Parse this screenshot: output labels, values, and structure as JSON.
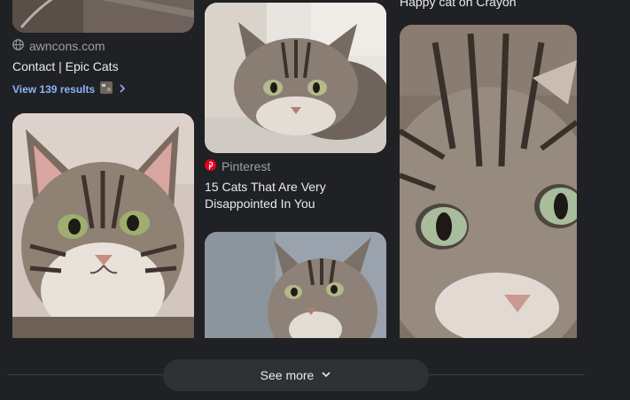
{
  "results": [
    {
      "source": "awncons.com",
      "title": "Contact | Epic Cats",
      "view_results": "View 139 results"
    },
    {
      "source": "Pinterest",
      "title_line1": "15 Cats That Are Very",
      "title_line2": "Disappointed In You"
    },
    {
      "title": "Happy cat on Crayon"
    }
  ],
  "see_more": {
    "label": "See more"
  },
  "colors": {
    "background": "#202124",
    "link": "#8ab4f8",
    "pinterest": "#e60023"
  },
  "icons": {
    "globe": "globe-icon",
    "pinterest": "pinterest-icon",
    "chevron_right": "chevron-right-icon",
    "chevron_down": "chevron-down-icon"
  }
}
